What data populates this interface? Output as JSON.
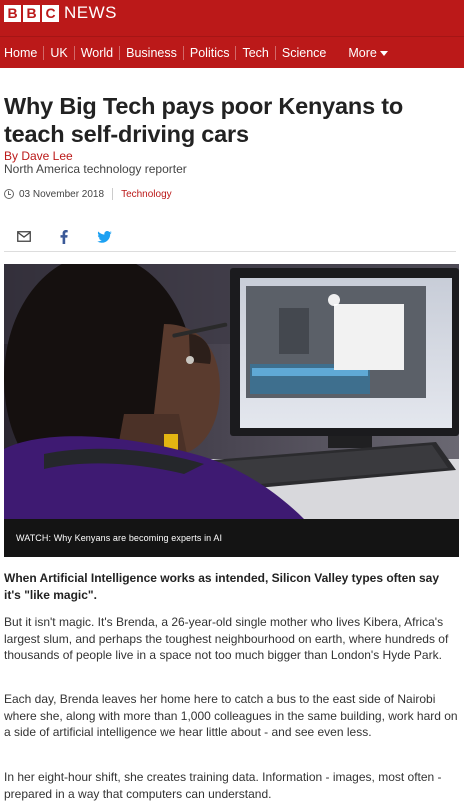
{
  "header": {
    "brand_blocks": [
      "B",
      "B",
      "C"
    ],
    "brand_word": "NEWS",
    "brand_color": "#bb1919"
  },
  "nav": {
    "items": [
      "Home",
      "UK",
      "World",
      "Business",
      "Politics",
      "Tech",
      "Science"
    ],
    "more": "More"
  },
  "article": {
    "headline": "Why Big Tech pays poor Kenyans to teach self-driving cars",
    "byline_name": "By Dave Lee",
    "byline_role": "North America technology reporter",
    "date": "03 November 2018",
    "topic": "Technology",
    "share_icons": [
      "email-icon",
      "facebook-icon",
      "twitter-icon"
    ],
    "media_caption": "WATCH: Why Kenyans are becoming experts in AI",
    "intro": "When Artificial Intelligence works as intended, Silicon Valley types often say it's \"like magic\".",
    "paragraphs": [
      "But it isn't magic. It's Brenda, a 26-year-old single mother who lives Kibera, Africa's largest slum, and perhaps the toughest neighbourhood on earth, where hundreds of thousands of people live in a space not too much bigger than London's Hyde Park.",
      "Each day, Brenda leaves her home here to catch a bus to the east side of Nairobi where she, along with more than 1,000 colleagues in the same building, work hard on a side of artificial intelligence we hear little about - and see even less.",
      "In her eight-hour shift, she creates training data. Information - images, most often - prepared in a way that computers can understand."
    ]
  }
}
